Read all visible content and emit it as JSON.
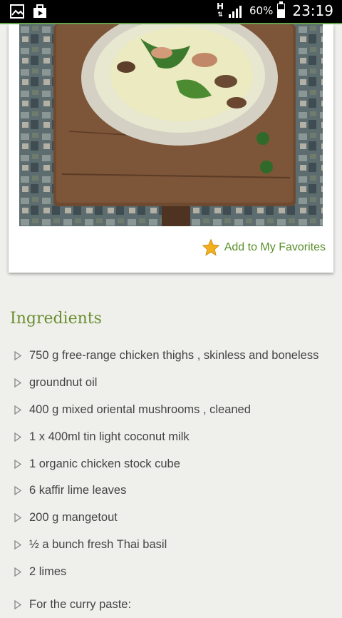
{
  "status_bar": {
    "network_type": "H",
    "battery_percent": "60%",
    "battery_level": 0.6,
    "time": "23:19",
    "icons": [
      "gallery-icon",
      "briefcase-icon",
      "signal-icon",
      "battery-icon"
    ]
  },
  "recipe": {
    "favorites_label": "Add to My Favorites",
    "ingredients_title": "Ingredients",
    "ingredients": [
      "750 g free-range chicken thighs , skinless and boneless",
      "groundnut oil",
      "400 g mixed oriental mushrooms , cleaned",
      "1 x 400ml tin light coconut milk",
      "1 organic chicken stock cube",
      "6 kaffir lime leaves",
      "200 g mangetout",
      "½ a bunch fresh Thai basil",
      "2 limes",
      "For the curry paste:"
    ]
  },
  "colors": {
    "accent_green": "#6a8e2e",
    "link_green": "#5a8f2a",
    "star_gold": "#f2b01e",
    "status_underline": "#6aa84f"
  }
}
